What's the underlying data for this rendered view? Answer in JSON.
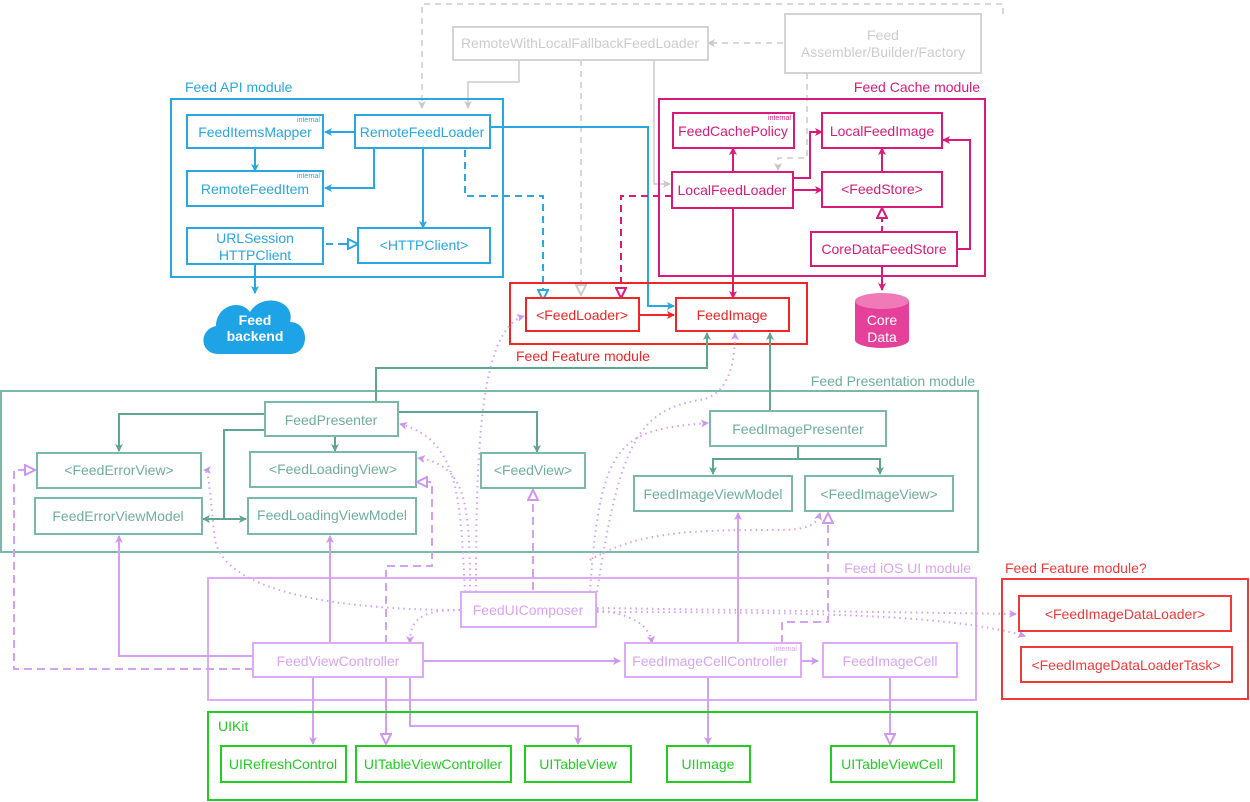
{
  "colors": {
    "api": "#2aa6e0",
    "cache": "#d81b7a",
    "feature": "#f02525",
    "presentation": "#6fae9c",
    "ios_ui": "#d8a4f4",
    "uikit": "#22cc22",
    "composition": "#cccccc",
    "feature_q": "#f03a3a"
  },
  "modules": {
    "api": "Feed API module",
    "cache": "Feed Cache module",
    "feature": "Feed Feature module",
    "presentation": "Feed Presentation module",
    "ios_ui": "Feed iOS UI module",
    "uikit": "UIKit",
    "feature_q": "Feed Feature module?"
  },
  "internal_tag": "internal",
  "nodes": {
    "remote_fallback": "RemoteWithLocalFallbackFeedLoader",
    "assembler_1": "Feed",
    "assembler_2": "Assembler/Builder/Factory",
    "feed_items_mapper": "FeedItemsMapper",
    "remote_feed_loader": "RemoteFeedLoader",
    "remote_feed_item": "RemoteFeedItem",
    "urlsession_1": "URLSession",
    "urlsession_2": "HTTPClient",
    "http_client": "<HTTPClient>",
    "backend_1": "Feed",
    "backend_2": "backend",
    "feed_cache_policy": "FeedCachePolicy",
    "local_feed_image": "LocalFeedImage",
    "local_feed_loader": "LocalFeedLoader",
    "feed_store": "<FeedStore>",
    "core_data_feed_store": "CoreDataFeedStore",
    "core_data_1": "Core",
    "core_data_2": "Data",
    "feed_loader": "<FeedLoader>",
    "feed_image": "FeedImage",
    "feed_presenter": "FeedPresenter",
    "feed_error_view": "<FeedErrorView>",
    "feed_loading_view": "<FeedLoadingView>",
    "feed_view": "<FeedView>",
    "feed_error_view_model": "FeedErrorViewModel",
    "feed_loading_view_model": "FeedLoadingViewModel",
    "feed_image_presenter": "FeedImagePresenter",
    "feed_image_view_model": "FeedImageViewModel",
    "feed_image_view": "<FeedImageView>",
    "feed_ui_composer": "FeedUIComposer",
    "feed_view_controller": "FeedViewController",
    "feed_image_cell_controller": "FeedImageCellController",
    "feed_image_cell": "FeedImageCell",
    "ui_refresh_control": "UIRefreshControl",
    "ui_table_view_controller": "UITableViewController",
    "ui_table_view": "UITableView",
    "ui_image": "UIImage",
    "ui_table_view_cell": "UITableViewCell",
    "feed_image_data_loader": "<FeedImageDataLoader>",
    "feed_image_data_loader_task": "<FeedImageDataLoaderTask>"
  }
}
